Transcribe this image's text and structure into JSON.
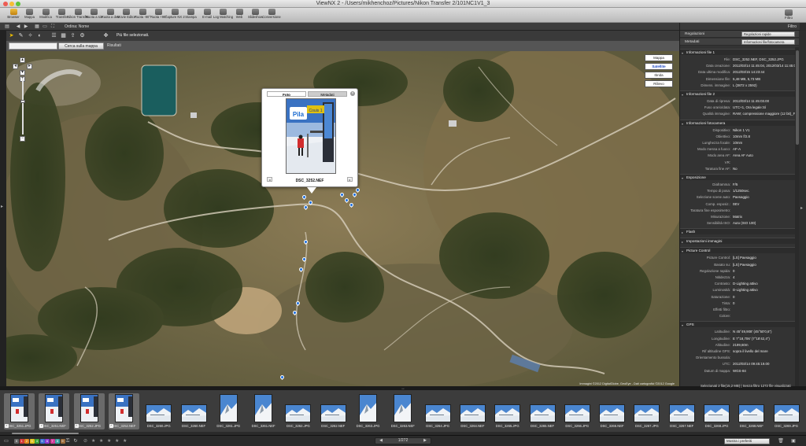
{
  "window": {
    "title": "ViewNX 2 - /Users/mikhenchoz/Pictures/Nikon Transfer 2/101NC1V1_3"
  },
  "toolbar": {
    "items": [
      {
        "label": "Browser",
        "icon": "browser-icon"
      },
      {
        "label": "Mappa",
        "icon": "map-icon"
      },
      {
        "label": "Modifica",
        "icon": "edit-icon"
      },
      {
        "label": "Transfer",
        "icon": "transfer-icon"
      },
      {
        "label": "Nikon Transfer",
        "icon": "nikon-transfer-icon"
      },
      {
        "label": "Ruota a sin",
        "icon": "rotate-left-icon"
      },
      {
        "label": "Ruota a des",
        "icon": "rotate-right-icon"
      },
      {
        "label": "Movie Editor",
        "icon": "movie-icon"
      },
      {
        "label": "Ruota -90°",
        "icon": "rotate-ccw-icon"
      },
      {
        "label": "Ruota +90°",
        "icon": "rotate-cw-icon"
      },
      {
        "label": "Capture NX 2",
        "icon": "capture-nx-icon"
      },
      {
        "label": "Stampa",
        "icon": "print-icon"
      },
      {
        "label": "E-mail",
        "icon": "mail-icon"
      },
      {
        "label": "Log Matching",
        "icon": "log-matching-icon"
      },
      {
        "label": "Web",
        "icon": "web-icon"
      },
      {
        "label": "Slideshow",
        "icon": "slideshow-icon"
      },
      {
        "label": "Conversione",
        "icon": "convert-icon"
      }
    ],
    "right_label": "Filtro"
  },
  "subbar": {
    "sort_label": "Ordina: Nome"
  },
  "maptools": {
    "hint": "Più file selezionati."
  },
  "search": {
    "value": "",
    "button_label": "Cerca sulla mappa",
    "results_label": "Risultati"
  },
  "map": {
    "types": [
      {
        "label": "Mappa",
        "active": false
      },
      {
        "label": "Satellite",
        "active": true
      },
      {
        "label": "Ibrida",
        "active": false
      },
      {
        "label": "Rilievo",
        "active": false
      }
    ],
    "copyright": "Immagini ©2012 DigitalGlobe, GeoEye - Dati cartografici ©2012 Google",
    "popup": {
      "tabs": [
        "Foto",
        "Metadati"
      ],
      "filename": "DSC_3252.NEF",
      "photo_sign": "Pila",
      "photo_sign_extra": "Couis 1"
    }
  },
  "panel": {
    "filter_label": "Filtro",
    "rows": [
      {
        "label": "Regolazioni",
        "value": "Regolazioni rapide"
      },
      {
        "label": "Metadati",
        "value": "Informazioni file/fotocamera"
      }
    ],
    "sections": [
      {
        "title": "Informazioni file 1",
        "items": [
          {
            "k": "File:",
            "v": "DSC_3252.NEF, DSC_3252.JPG"
          },
          {
            "k": "Data creazione:",
            "v": "2012/03/14 11:45:04, 2012/03/14 11:45:04"
          },
          {
            "k": "Data ultima modifica:",
            "v": "2012/03/15 14:23:44"
          },
          {
            "k": "Dimensione file:",
            "v": "5,48 MB, 5,73 MB"
          },
          {
            "k": "Dimens. immagine:",
            "v": "L (3872 x 2592)"
          }
        ]
      },
      {
        "title": "Informazioni file 2",
        "items": [
          {
            "k": "Data di ripresa:",
            "v": "2012/03/14 11:45:03.00"
          },
          {
            "k": "Fuso orario/data:",
            "v": "UTC+1, Ora legale:Sì"
          },
          {
            "k": "Qualità immagine:",
            "v": "RAW; compressione maggiore (12 bit)_Fine"
          }
        ]
      },
      {
        "title": "Informazioni fotocamera",
        "items": [
          {
            "k": "Dispositivo:",
            "v": "Nikon 1 V1"
          },
          {
            "k": "Obiettivo:",
            "v": "10mm f/2.8"
          },
          {
            "k": "Lunghezza focale:",
            "v": "10mm"
          },
          {
            "k": "Modo messa a fuoco:",
            "v": "AF-A"
          },
          {
            "k": "Modo area AF:",
            "v": "Area AF Auto"
          },
          {
            "k": "VR:",
            "v": ""
          },
          {
            "k": "Taratura fine AF:",
            "v": "No"
          }
        ]
      },
      {
        "title": "Esposizione",
        "items": [
          {
            "k": "Diaframma:",
            "v": "F/5"
          },
          {
            "k": "Tempo di posa:",
            "v": "1/1250sec."
          },
          {
            "k": "Selezione scene auto:",
            "v": "Paesaggio"
          },
          {
            "k": "Comp. esposiz.:",
            "v": "0EV"
          },
          {
            "k": "Taratura fine esposimetro:",
            "v": ""
          },
          {
            "k": "Misurazione:",
            "v": "Matrix"
          },
          {
            "k": "Sensibilità ISO:",
            "v": "Auto (ISO 100)"
          }
        ]
      },
      {
        "title": "Flash",
        "items": []
      },
      {
        "title": "Impostazioni immagini",
        "items": []
      },
      {
        "title": "Picture Control",
        "items": [
          {
            "k": "Picture Control:",
            "v": "[LS] Paesaggio"
          },
          {
            "k": "Basato su:",
            "v": "[LS] Paesaggio"
          },
          {
            "k": "Regolazione rapida:",
            "v": "0"
          },
          {
            "k": "Nitidezza:",
            "v": "4"
          },
          {
            "k": "Contrasto:",
            "v": "D-Lighting attivo"
          },
          {
            "k": "Luminosità:",
            "v": "D-Lighting attivo"
          },
          {
            "k": "Saturazione:",
            "v": "0"
          },
          {
            "k": "Tinta:",
            "v": "0"
          },
          {
            "k": "Effetti filtro:",
            "v": ""
          },
          {
            "k": "Colore:",
            "v": ""
          }
        ]
      },
      {
        "title": "GPS",
        "items": [
          {
            "k": "Latitudine:",
            "v": "N 45°49,908' (45°50'0,6\")"
          },
          {
            "k": "Longitudine:",
            "v": "E 7°18,706' (7°18'42,4\")"
          },
          {
            "k": "Altitudine:",
            "v": "2199,60m"
          },
          {
            "k": "Rif altitudine GPS:",
            "v": "sopra il livello del mare"
          },
          {
            "k": "Orientamento bussola:",
            "v": ""
          },
          {
            "k": "UTC:",
            "v": "2012/03/14 09:45:19.00"
          },
          {
            "k": "Datum di mappa:",
            "v": "WGS-84"
          }
        ]
      }
    ],
    "footer": "Selezionati 2 file(15,2 MB) | Senza filtro 1272 file visualizzati"
  },
  "filmstrip": {
    "items": [
      {
        "name": "DSC_3251.JPG",
        "orient": "p",
        "selected": true,
        "scene": "gate"
      },
      {
        "name": "DSC_3251.NEF",
        "orient": "p",
        "selected": true,
        "scene": "gate"
      },
      {
        "name": "DSC_3252.JPG",
        "orient": "p",
        "selected": true,
        "scene": "gate"
      },
      {
        "name": "DSC_3252.NEF",
        "orient": "p",
        "selected": true,
        "scene": "gate"
      },
      {
        "name": "DSC_3260.JPG",
        "orient": "l",
        "selected": false,
        "scene": "snow"
      },
      {
        "name": "DSC_3260.NEF",
        "orient": "l",
        "selected": false,
        "scene": "snow"
      },
      {
        "name": "DSC_3261.JPG",
        "orient": "p",
        "selected": false,
        "scene": "peak"
      },
      {
        "name": "DSC_3261.NEF",
        "orient": "p",
        "selected": false,
        "scene": "peak"
      },
      {
        "name": "DSC_3262.JPG",
        "orient": "l",
        "selected": false,
        "scene": "snow"
      },
      {
        "name": "DSC_3262.NEF",
        "orient": "l",
        "selected": false,
        "scene": "snow"
      },
      {
        "name": "DSC_3263.JPG",
        "orient": "p",
        "selected": false,
        "scene": "peak"
      },
      {
        "name": "DSC_3263.NEF",
        "orient": "p",
        "selected": false,
        "scene": "peak"
      },
      {
        "name": "DSC_3264.JPG",
        "orient": "l",
        "selected": false,
        "scene": "snow"
      },
      {
        "name": "DSC_3264.NEF",
        "orient": "l",
        "selected": false,
        "scene": "snow"
      },
      {
        "name": "DSC_3265.JPG",
        "orient": "l",
        "selected": false,
        "scene": "snow"
      },
      {
        "name": "DSC_3265.NEF",
        "orient": "l",
        "selected": false,
        "scene": "snow"
      },
      {
        "name": "DSC_3266.JPG",
        "orient": "l",
        "selected": false,
        "scene": "snow"
      },
      {
        "name": "DSC_3266.NEF",
        "orient": "l",
        "selected": false,
        "scene": "snow"
      },
      {
        "name": "DSC_3267.JPG",
        "orient": "l",
        "selected": false,
        "scene": "snow"
      },
      {
        "name": "DSC_3267.NEF",
        "orient": "l",
        "selected": false,
        "scene": "snow"
      },
      {
        "name": "DSC_3268.JPG",
        "orient": "l",
        "selected": false,
        "scene": "snow"
      },
      {
        "name": "DSC_3268.NEF",
        "orient": "l",
        "selected": false,
        "scene": "snow"
      },
      {
        "name": "DSC_3269.JPG",
        "orient": "l",
        "selected": false,
        "scene": "snow"
      }
    ]
  },
  "statusbar": {
    "page": "1/272",
    "select_label": "Mostra i preferiti",
    "label_numbers": [
      "0",
      "1",
      "2",
      "3",
      "4",
      "5",
      "6",
      "7",
      "8",
      "9"
    ],
    "label_colors": [
      "#666666",
      "#d23b3b",
      "#e0871f",
      "#e0c21f",
      "#3ba23b",
      "#3b6fd2",
      "#8a3bd2",
      "#d23b9b",
      "#3ba2a2",
      "#9b6b3b"
    ]
  },
  "colors": {
    "accent": "#1d6fe0",
    "panel_bg": "#333333"
  }
}
